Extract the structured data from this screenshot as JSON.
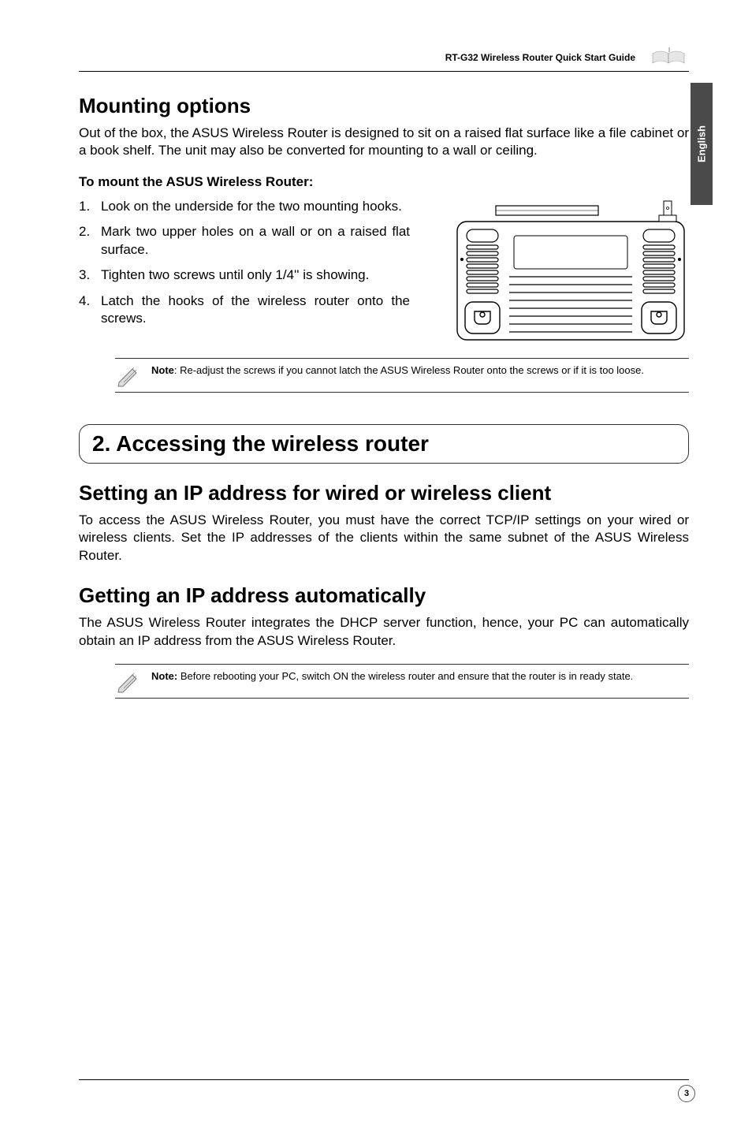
{
  "header": {
    "doc_title": "RT-G32 Wireless Router Quick Start Guide"
  },
  "side_tab": "English",
  "mounting": {
    "title": "Mounting options",
    "intro": "Out of the box, the ASUS Wireless Router is designed to sit on a raised flat surface like a file cabinet or a book shelf. The unit may also be converted for mounting to a wall or ceiling.",
    "subhead": "To mount the ASUS Wireless Router:",
    "steps": [
      "Look on the underside for the two mounting hooks.",
      "Mark two upper holes on a wall or on a raised flat surface.",
      "Tighten two screws until only 1/4'' is showing.",
      "Latch the hooks of the wireless router onto the screws."
    ],
    "note_bold": "Note",
    "note_text": ": Re-adjust the screws if you cannot latch the ASUS Wireless Router onto the screws or if it is too loose."
  },
  "accessing": {
    "box_title": "2. Accessing the wireless router",
    "setting_ip_title": "Setting an IP address for wired or wireless client",
    "setting_ip_body": "To access the ASUS Wireless Router, you must have the correct TCP/IP settings on your wired or wireless clients. Set the IP addresses of the clients within the same subnet of the ASUS Wireless Router.",
    "getting_ip_title": "Getting an IP address automatically",
    "getting_ip_body": "The ASUS Wireless Router integrates the DHCP server function, hence, your PC can automatically obtain an IP address from the ASUS Wireless Router.",
    "note_bold": "Note:",
    "note_text": " Before rebooting your PC, switch ON the wireless router and ensure that the router is in ready state."
  },
  "page_number": "3"
}
